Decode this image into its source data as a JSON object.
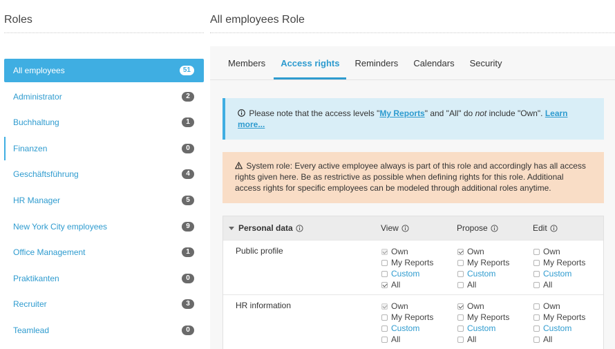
{
  "sidebar": {
    "title": "Roles",
    "items": [
      {
        "label": "All employees",
        "count": "51"
      },
      {
        "label": "Administrator",
        "count": "2"
      },
      {
        "label": "Buchhaltung",
        "count": "1"
      },
      {
        "label": "Finanzen",
        "count": "0"
      },
      {
        "label": "Geschäftsführung",
        "count": "4"
      },
      {
        "label": "HR Manager",
        "count": "5"
      },
      {
        "label": "New York City employees",
        "count": "9"
      },
      {
        "label": "Office Management",
        "count": "1"
      },
      {
        "label": "Praktikanten",
        "count": "0"
      },
      {
        "label": "Recruiter",
        "count": "3"
      },
      {
        "label": "Teamlead",
        "count": "0"
      }
    ]
  },
  "main": {
    "title": "All employees Role",
    "tabs": [
      {
        "label": "Members"
      },
      {
        "label": "Access rights"
      },
      {
        "label": "Reminders"
      },
      {
        "label": "Calendars"
      },
      {
        "label": "Security"
      }
    ],
    "info_alert": {
      "before": "Please note that the access levels \"",
      "link": "My Reports",
      "middle": "\" and \"All\" do ",
      "emph": "not",
      "after": " include \"Own\". ",
      "learn_more": "Learn more..."
    },
    "warning_alert": {
      "text": "System role: Every active employee always is part of this role and accordingly has all access rights given here. Be as restrictive as possible when defining rights for this role. Additional access rights for specific employees can be modeled through additional roles anytime."
    },
    "table": {
      "section": "Personal data",
      "columns": {
        "view": "View",
        "propose": "Propose",
        "edit": "Edit"
      },
      "options": {
        "own": "Own",
        "my_reports": "My Reports",
        "custom": "Custom",
        "all": "All"
      },
      "rows": [
        {
          "label": "Public profile"
        },
        {
          "label": "HR information"
        }
      ]
    }
  },
  "colors": {
    "accent": "#3faee2",
    "link": "#2e9bcf",
    "info_bg": "#d9eef7",
    "warn_bg": "#f9ddc6"
  }
}
